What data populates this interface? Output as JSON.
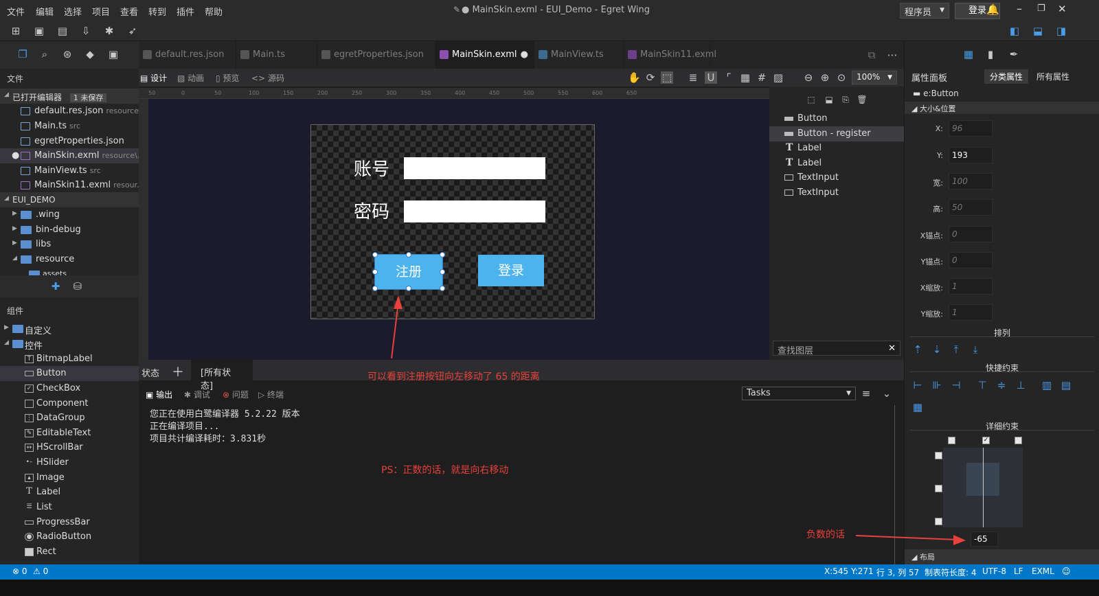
{
  "menu": [
    "文件",
    "编辑",
    "选择",
    "项目",
    "查看",
    "转到",
    "插件",
    "帮助"
  ],
  "window_title": "● MainSkin.exml - EUI_Demo - Egret Wing",
  "role": "程序员",
  "login_label": "登录",
  "tabs": [
    {
      "label": "default.res.json",
      "active": false
    },
    {
      "label": "Main.ts",
      "active": false
    },
    {
      "label": "egretProperties.json",
      "active": false
    },
    {
      "label": "MainSkin.exml",
      "active": true,
      "modified": "●"
    },
    {
      "label": "MainView.ts",
      "active": false
    },
    {
      "label": "MainSkin11.exml",
      "active": false
    }
  ],
  "explorer": {
    "title": "文件",
    "open_editors": "已打开编辑器",
    "unsaved_badge": "1 未保存",
    "open_files": [
      {
        "name": "default.res.json",
        "sub": "resource"
      },
      {
        "name": "Main.ts",
        "sub": "src"
      },
      {
        "name": "egretProperties.json",
        "sub": ""
      },
      {
        "name": "MainSkin.exml",
        "sub": "resource\\..."
      },
      {
        "name": "MainView.ts",
        "sub": "src"
      },
      {
        "name": "MainSkin11.exml",
        "sub": "resour..."
      }
    ],
    "project": "EUI_DEMO",
    "folders": [
      ".wing",
      "bin-debug",
      "libs",
      "resource",
      "assets"
    ]
  },
  "components": {
    "title": "组件",
    "groups": [
      "自定义",
      "控件"
    ],
    "items": [
      "BitmapLabel",
      "Button",
      "CheckBox",
      "Component",
      "DataGroup",
      "EditableText",
      "HScrollBar",
      "HSlider",
      "Image",
      "Label",
      "List",
      "ProgressBar",
      "RadioButton",
      "Rect"
    ],
    "selected": "Button"
  },
  "design_modes": [
    "设计",
    "动画",
    "预览",
    "源码"
  ],
  "zoom": "100%",
  "ruler_ticks": [
    "50",
    "0",
    "50",
    "100",
    "150",
    "200",
    "250",
    "300",
    "350",
    "400",
    "450",
    "500",
    "550",
    "600",
    "650"
  ],
  "artboard": {
    "account_label": "账号",
    "password_label": "密码",
    "register_button": "注册",
    "login_button": "登录"
  },
  "layers": {
    "items": [
      "Button",
      "Button - register",
      "Label",
      "Label",
      "TextInput",
      "TextInput"
    ],
    "selected_index": 1,
    "search_placeholder": "查找图层"
  },
  "states": {
    "label": "状态",
    "all": "[所有状态]"
  },
  "output": {
    "tabs": [
      "输出",
      "调试",
      "问题",
      "终端"
    ],
    "tasks": "Tasks",
    "lines": [
      "您正在使用白鹭编译器 5.2.22 版本",
      "正在编译项目...",
      "项目共计编译耗时：3.831秒"
    ]
  },
  "annotations": {
    "moved_left": "可以看到注册按钮向左移动了 65 的距离",
    "positive_note": "PS：正数的话，就是向右移动",
    "negative_note": "负数的话"
  },
  "properties": {
    "title": "属性面板",
    "tab_category": "分类属性",
    "tab_all": "所有属性",
    "component": "e:Button",
    "section_size": "大小&位置",
    "fields": [
      {
        "label": "X:",
        "value": "96",
        "placeholder": true
      },
      {
        "label": "Y:",
        "value": "193",
        "placeholder": false
      },
      {
        "label": "宽:",
        "value": "100",
        "placeholder": true
      },
      {
        "label": "高:",
        "value": "50",
        "placeholder": true
      },
      {
        "label": "X锚点:",
        "value": "0",
        "placeholder": true
      },
      {
        "label": "Y锚点:",
        "value": "0",
        "placeholder": true
      },
      {
        "label": "X缩放:",
        "value": "1",
        "placeholder": true
      },
      {
        "label": "Y缩放:",
        "value": "1",
        "placeholder": true
      }
    ],
    "arrange": "排列",
    "quick_constraints": "快捷约束",
    "detail_constraints": "详细约束",
    "horizontal_center": "-65",
    "layout": "布局"
  },
  "statusbar": {
    "errors": "0",
    "warnings": "0",
    "cursor": "X:545 Y:271",
    "position": "行 3, 列 57",
    "tab_size": "制表符长度: 4",
    "encoding": "UTF-8",
    "eol": "LF",
    "language": "EXML"
  },
  "colors": {
    "accent": "#0077c8",
    "button": "#4cb3ee",
    "annotation": "#e8413b"
  }
}
